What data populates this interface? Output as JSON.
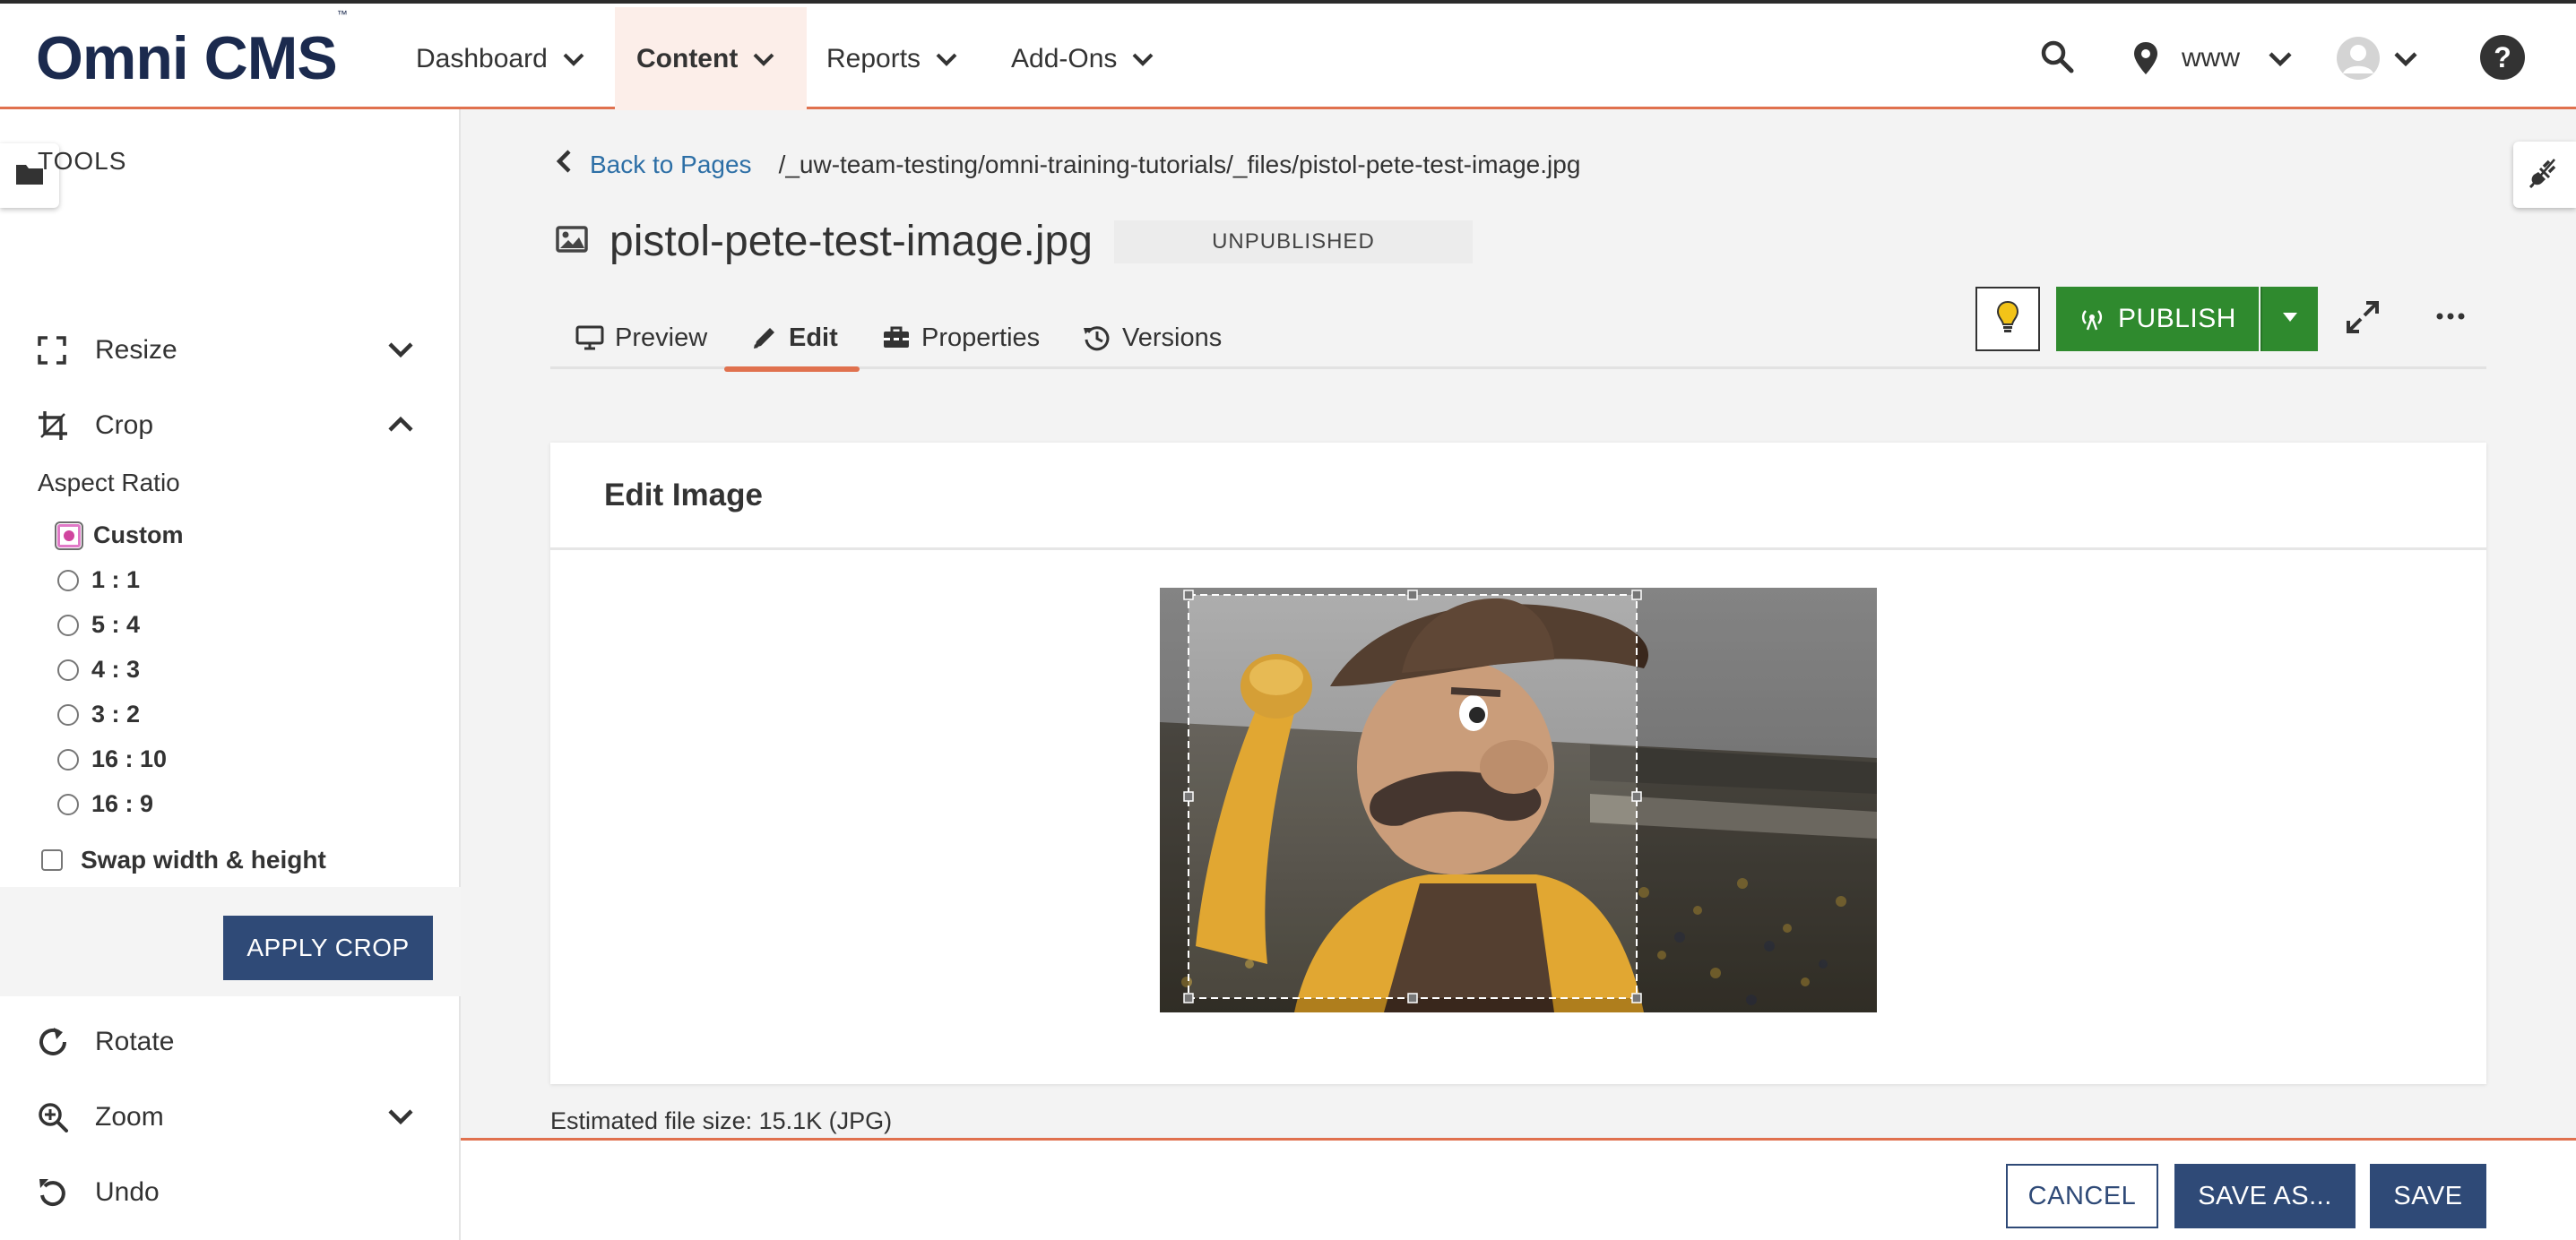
{
  "app": {
    "logo_text": "Omni CMS",
    "logo_mark": "™"
  },
  "nav": {
    "items": [
      {
        "label": "Dashboard"
      },
      {
        "label": "Content"
      },
      {
        "label": "Reports"
      },
      {
        "label": "Add-Ons"
      }
    ],
    "active": "Content",
    "site": "www"
  },
  "sidebar": {
    "tools_title": "TOOLS",
    "tools": {
      "resize": "Resize",
      "crop": "Crop",
      "rotate": "Rotate",
      "zoom": "Zoom",
      "undo": "Undo"
    },
    "aspect_ratio_label": "Aspect Ratio",
    "aspect_options": [
      "Custom",
      "1 : 1",
      "5 : 4",
      "4 : 3",
      "3 : 2",
      "16 : 10",
      "16 : 9"
    ],
    "aspect_selected": "Custom",
    "swap_label": "Swap width & height",
    "swap_checked": false,
    "apply_label": "APPLY CROP"
  },
  "page": {
    "back_label": "Back to Pages",
    "path": "/_uw-team-testing/omni-training-tutorials/_files/pistol-pete-test-image.jpg",
    "file_name": "pistol-pete-test-image.jpg",
    "status": "UNPUBLISHED",
    "tabs": [
      {
        "label": "Preview"
      },
      {
        "label": "Edit"
      },
      {
        "label": "Properties"
      },
      {
        "label": "Versions"
      }
    ],
    "active_tab": "Edit",
    "publish_label": "PUBLISH"
  },
  "editor": {
    "heading": "Edit Image",
    "file_size": "Estimated file size: 15.1K (JPG)"
  },
  "footer": {
    "cancel": "CANCEL",
    "save_as": "SAVE AS...",
    "save": "SAVE"
  },
  "colors": {
    "accent": "#e0714e",
    "brand": "#1b2a4e",
    "primary_button": "#2f4a77",
    "publish": "#2f8a2e",
    "link": "#2d6fa6"
  }
}
